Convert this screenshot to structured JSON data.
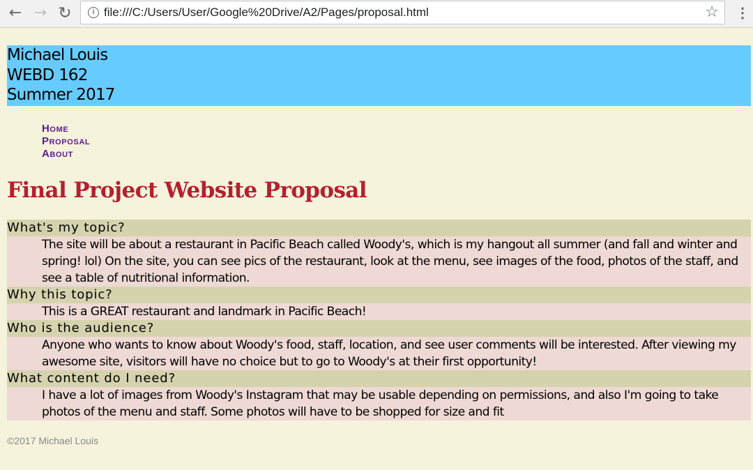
{
  "browser": {
    "url": "file:///C:/Users/User/Google%20Drive/A2/Pages/proposal.html"
  },
  "header": {
    "name": "Michael Louis",
    "course": "WEBD 162",
    "term": "Summer 2017"
  },
  "nav": {
    "items": [
      "Home",
      "Proposal",
      "About"
    ]
  },
  "main": {
    "title": "Final Project Website Proposal",
    "sections": [
      {
        "question": "What's my topic?",
        "answer": "The site will be about a restaurant in Pacific Beach called Woody's, which is my hangout all summer (and fall and winter and spring! lol) On the site, you can see pics of the restaurant, look at the menu, see images of the food, photos of the staff, and see a table of nutritional information."
      },
      {
        "question": "Why this topic?",
        "answer": "This is a GREAT restaurant and landmark in Pacific Beach!"
      },
      {
        "question": "Who is the audience?",
        "answer": "Anyone who wants to know about Woody's food, staff, location, and see user comments will be interested. After viewing my awesome site, visitors will have no choice but to go to Woody's at their first opportunity!"
      },
      {
        "question": "What content do I need?",
        "answer": "I have a lot of images from Woody's Instagram that may be usable depending on permissions, and also I'm going to take photos of the menu and staff. Some photos will have to be shopped for size and fit"
      }
    ]
  },
  "footer": {
    "text": "©2017 Michael Louis"
  },
  "colors": {
    "page_background": "#f5f3dc",
    "header_background": "#66ccff",
    "title": "#b5202e",
    "nav_link": "#5c1a8b",
    "question_background": "#d5d3ae",
    "answer_background": "#eed9d4",
    "footer_text": "#888888"
  }
}
